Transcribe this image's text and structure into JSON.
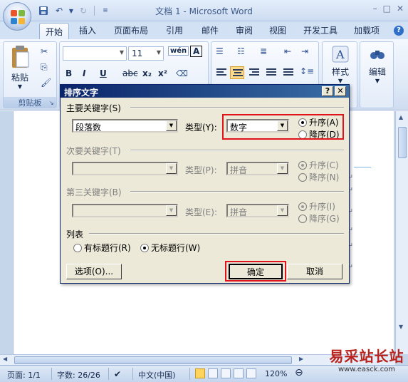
{
  "window": {
    "title": "文档 1 - Microsoft Word",
    "controls": [
      "–",
      "□",
      "✕"
    ]
  },
  "qat": {
    "save_icon": "save-icon",
    "undo_icon": "undo-icon",
    "redo_icon": "redo-icon"
  },
  "tabs": [
    {
      "label": "开始",
      "active": true
    },
    {
      "label": "插入"
    },
    {
      "label": "页面布局"
    },
    {
      "label": "引用"
    },
    {
      "label": "邮件"
    },
    {
      "label": "审阅"
    },
    {
      "label": "视图"
    },
    {
      "label": "开发工具"
    },
    {
      "label": "加载项"
    }
  ],
  "ribbon": {
    "clipboard": {
      "paste_label": "粘贴",
      "group_label": "剪贴板"
    },
    "font": {
      "font_name": "",
      "font_size": "11",
      "bold": "B",
      "italic": "I",
      "underline": "U",
      "strike": "abc",
      "subscript": "x₂",
      "superscript": "x²",
      "phonetic": "wén",
      "charborder": "A"
    },
    "styles": {
      "label": "样式"
    },
    "editing": {
      "label": "编辑"
    }
  },
  "dialog": {
    "title": "排序文字",
    "help": "?",
    "close": "✕",
    "primary": {
      "label": "主要关键字(S)",
      "field": "段落数",
      "type_label": "类型(Y):",
      "type_value": "数字",
      "asc": "升序(A)",
      "desc": "降序(D)",
      "selected": "asc"
    },
    "secondary": {
      "label": "次要关键字(T)",
      "field": "",
      "type_label": "类型(P):",
      "type_value": "拼音",
      "asc": "升序(C)",
      "desc": "降序(N)"
    },
    "tertiary": {
      "label": "第三关键字(B)",
      "field": "",
      "type_label": "类型(E):",
      "type_value": "拼音",
      "asc": "升序(I)",
      "desc": "降序(G)"
    },
    "list": {
      "label": "列表",
      "has_header": "有标题行(R)",
      "no_header": "无标题行(W)",
      "selected": "no_header"
    },
    "buttons": {
      "options": "选项(O)...",
      "ok": "确定",
      "cancel": "取消"
    }
  },
  "document": {
    "para_mark": "↵"
  },
  "statusbar": {
    "page": "页面: 1/1",
    "words": "字数: 26/26",
    "language": "中文(中国)",
    "zoom": "120%"
  },
  "watermark": {
    "brand": "易采站长站",
    "url": "www.easck.com"
  },
  "colors": {
    "highlight_box": "#e0141a",
    "dialog_title": "#0a246a",
    "ribbon_bg": "#dde8f6"
  }
}
